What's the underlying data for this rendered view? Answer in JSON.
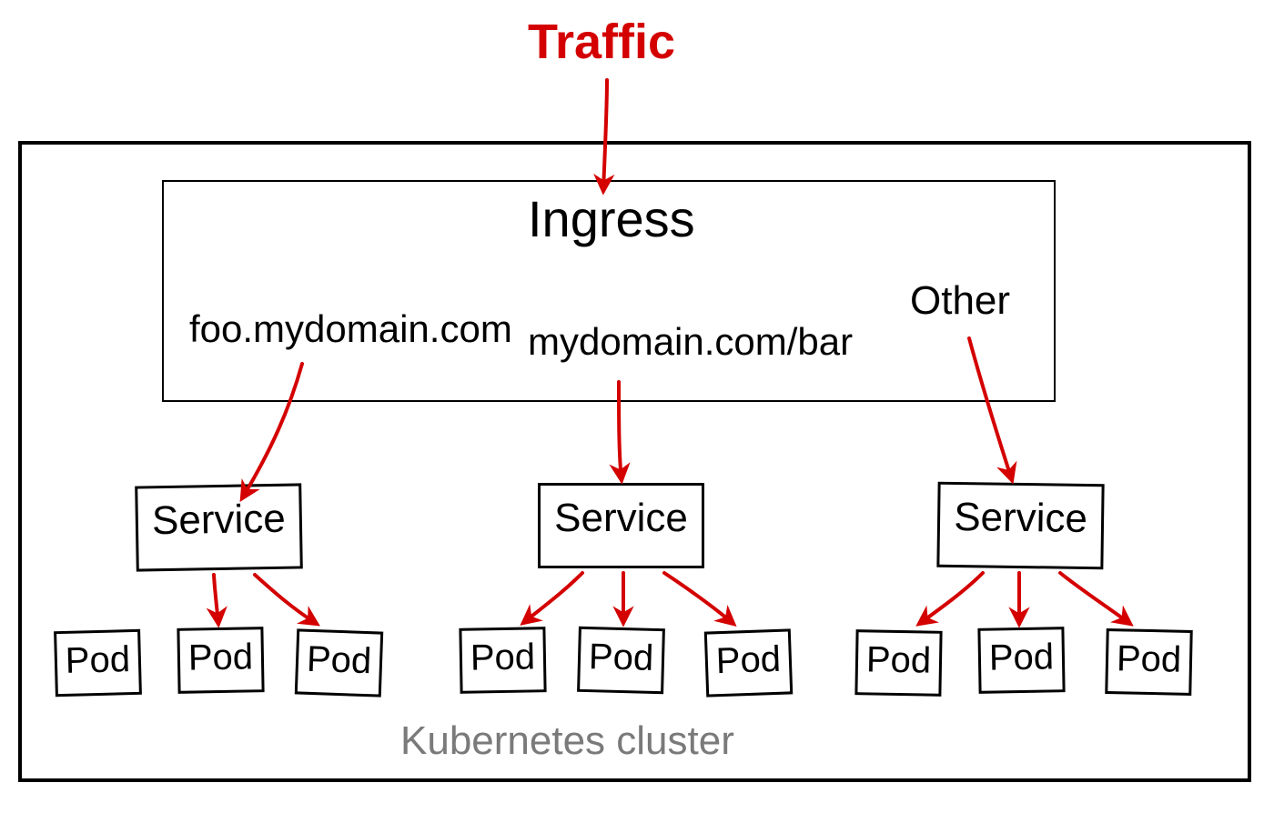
{
  "traffic_label": "Traffic",
  "cluster_label": "Kubernetes cluster",
  "ingress": {
    "title": "Ingress",
    "routes": {
      "a": "foo.mydomain.com",
      "b": "mydomain.com/bar",
      "c": "Other"
    }
  },
  "services": {
    "a": "Service",
    "b": "Service",
    "c": "Service"
  },
  "pods": {
    "a1": "Pod",
    "a2": "Pod",
    "a3": "Pod",
    "b1": "Pod",
    "b2": "Pod",
    "b3": "Pod",
    "c1": "Pod",
    "c2": "Pod",
    "c3": "Pod"
  },
  "colors": {
    "arrow": "#d40000",
    "text": "#000000",
    "muted": "#7a7a7a"
  }
}
